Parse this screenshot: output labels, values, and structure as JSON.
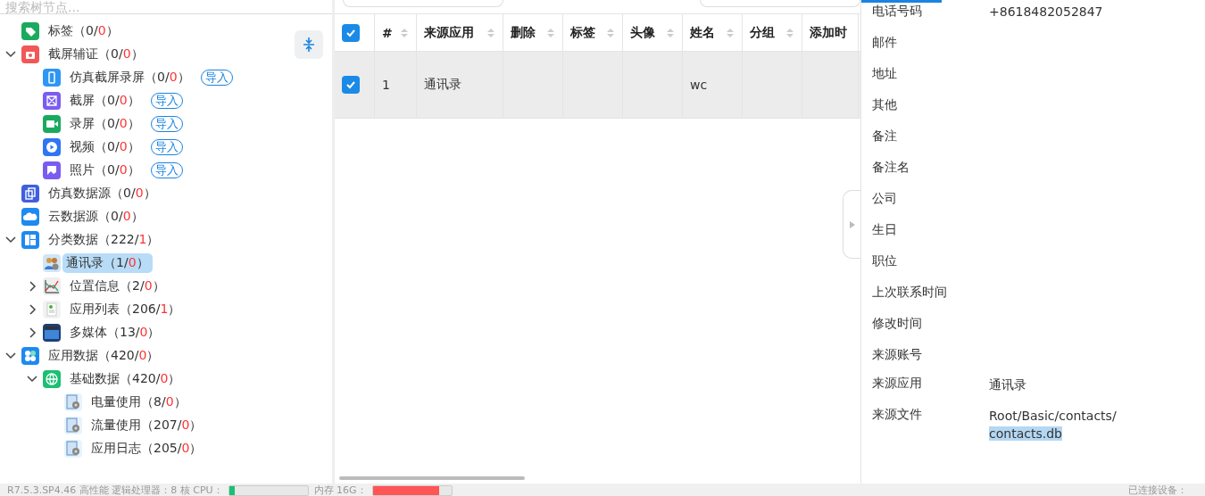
{
  "tree_search": {
    "placeholder": "搜索树节点..."
  },
  "tree": [
    {
      "kind": "tag",
      "text": "标签（0/",
      "red": "0",
      "tail": "）",
      "selected": false
    },
    {
      "kind": "camera",
      "text": "截屏辅证（0/",
      "red": "0",
      "tail": "）",
      "selected": false,
      "expanded": true,
      "children": [
        {
          "kind": "phone",
          "text": "仿真截屏录屏（0/",
          "red": "0",
          "tail": "）",
          "selected": false,
          "import_button": "导入"
        },
        {
          "kind": "crop",
          "text": "截屏（0/",
          "red": "0",
          "tail": "）",
          "selected": false,
          "import_button": "导入"
        },
        {
          "kind": "video",
          "text": "录屏（0/",
          "red": "0",
          "tail": "）",
          "selected": false,
          "import_button": "导入"
        },
        {
          "kind": "play",
          "text": "视频（0/",
          "red": "0",
          "tail": "）",
          "selected": false,
          "import_button": "导入"
        },
        {
          "kind": "photo",
          "text": "照片（0/",
          "red": "0",
          "tail": "）",
          "selected": false,
          "import_button": "导入"
        }
      ]
    },
    {
      "kind": "copy",
      "text": "仿真数据源（0/",
      "red": "0",
      "tail": "）",
      "selected": false
    },
    {
      "kind": "cloud",
      "text": "云数据源（0/",
      "red": "0",
      "tail": "）",
      "selected": false
    },
    {
      "kind": "grid",
      "text": "分类数据（222/",
      "red": "1",
      "tail": "）",
      "selected": false,
      "expanded": true,
      "children": [
        {
          "kind": "people",
          "text": "通讯录（1/",
          "red": "0",
          "tail": "）",
          "selected": true
        },
        {
          "kind": "chart",
          "text": "位置信息（2/",
          "red": "0",
          "tail": "）",
          "selected": false,
          "expanded": false
        },
        {
          "kind": "document",
          "text": "应用列表（206/",
          "red": "1",
          "tail": "）",
          "selected": false,
          "expanded": false
        },
        {
          "kind": "film",
          "text": "多媒体（13/",
          "red": "0",
          "tail": "）",
          "selected": false,
          "expanded": false
        }
      ]
    },
    {
      "kind": "apps",
      "text": "应用数据（420/",
      "red": "0",
      "tail": "）",
      "selected": false,
      "expanded": true,
      "children": [
        {
          "kind": "globe",
          "text": "基础数据（420/",
          "red": "0",
          "tail": "）",
          "selected": false,
          "expanded": true,
          "children": [
            {
              "kind": "gear-doc",
              "text": "电量使用（8/",
              "red": "0",
              "tail": "）",
              "selected": false
            },
            {
              "kind": "gear-doc",
              "text": "流量使用（207/",
              "red": "0",
              "tail": "）",
              "selected": false
            },
            {
              "kind": "gear-doc",
              "text": "应用日志（205/",
              "red": "0",
              "tail": "）",
              "selected": false
            }
          ]
        }
      ]
    }
  ],
  "table": {
    "select_all": {
      "checked": true
    },
    "columns": [
      {
        "label": "#",
        "sortable": true
      },
      {
        "label": "来源应用",
        "sortable": true
      },
      {
        "label": "删除",
        "sortable": true
      },
      {
        "label": "标签",
        "sortable": true
      },
      {
        "label": "头像",
        "sortable": true
      },
      {
        "label": "姓名",
        "sortable": true
      },
      {
        "label": "分组",
        "sortable": true
      },
      {
        "label": "添加时"
      }
    ],
    "rows": [
      {
        "checked": true,
        "selected": true,
        "cells": [
          "1",
          "通讯录",
          "",
          "",
          "",
          "wc",
          "",
          ""
        ]
      }
    ]
  },
  "details": [
    {
      "label": "电话号码",
      "value": "+8618482052847"
    },
    {
      "label": "邮件"
    },
    {
      "label": "地址"
    },
    {
      "label": "其他"
    },
    {
      "label": "备注"
    },
    {
      "label": "备注名"
    },
    {
      "label": "公司"
    },
    {
      "label": "生日"
    },
    {
      "label": "职位"
    },
    {
      "label": "上次联系时间"
    },
    {
      "label": "修改时间"
    },
    {
      "label": "来源账号"
    }
  ],
  "source": [
    {
      "label": "来源应用",
      "value": [
        {
          "text": "通讯录",
          "selected": false
        }
      ]
    },
    {
      "label": "来源文件",
      "value": [
        {
          "text": "Root/Basic/contacts/",
          "selected": false
        },
        {
          "text": "contacts.db",
          "selected": true
        }
      ]
    }
  ],
  "status_bar": {
    "version": "R7.5.3.SP4.46  高性能  逻辑处理器：8 核  CPU：",
    "cpu": {
      "level": 0.07
    },
    "memory_label": "内存 16G：",
    "memory": {
      "level": 0.85
    },
    "devices": "已连接设备："
  }
}
